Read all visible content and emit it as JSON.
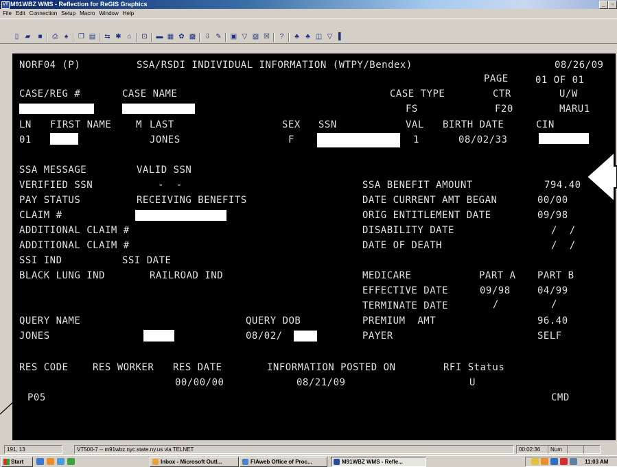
{
  "window": {
    "title": "M91WBZ WMS - Reflection for ReGIS Graphics",
    "icon_label": "VT"
  },
  "menu": [
    "File",
    "Edit",
    "Connection",
    "Setup",
    "Macro",
    "Window",
    "Help"
  ],
  "terminal": {
    "header": {
      "screen_id": "NORF04 (P)",
      "screen_title": "SSA/RSDI INDIVIDUAL INFORMATION (WTPY/Bendex)",
      "date": "08/26/09",
      "page_label": "PAGE",
      "page_value": "01 OF 01"
    },
    "case_row": {
      "case_reg_label": "CASE/REG #",
      "case_name_label": "CASE NAME",
      "case_type_label": "CASE TYPE",
      "ctr_label": "CTR",
      "uw_label": "U/W",
      "case_type_value": "FS",
      "ctr_value": "F20",
      "uw_value": "MARU1"
    },
    "individual": {
      "ln_label": "LN",
      "first_name_label": "FIRST NAME",
      "m_label": "M",
      "last_label": "LAST",
      "sex_label": "SEX",
      "ssn_label": "SSN",
      "val_label": "VAL",
      "birth_date_label": "BIRTH DATE",
      "cin_label": "CIN",
      "ln_value": "01",
      "last_value": "JONES",
      "sex_value": "F",
      "val_value": "1",
      "birth_date_value": "08/02/33"
    },
    "left_fields": {
      "ssa_message_label": "SSA MESSAGE",
      "ssa_message_value": "VALID SSN",
      "verified_ssn_label": "VERIFIED SSN",
      "verified_ssn_value": "-  -",
      "pay_status_label": "PAY STATUS",
      "pay_status_value": "RECEIVING BENEFITS",
      "claim_label": "CLAIM #",
      "additional_claim_label_1": "ADDITIONAL CLAIM #",
      "additional_claim_label_2": "ADDITIONAL CLAIM #",
      "ssi_ind_label": "SSI IND",
      "ssi_date_label": "SSI DATE",
      "black_lung_label": "BLACK LUNG IND",
      "railroad_label": "RAILROAD IND"
    },
    "right_fields": {
      "ssa_benefit_label": "SSA BENEFIT AMOUNT",
      "ssa_benefit_value": "794.40",
      "date_current_amt_label": "DATE CURRENT AMT BEGAN",
      "date_current_amt_value": "00/00",
      "orig_entitlement_label": "ORIG ENTITLEMENT DATE",
      "orig_entitlement_value": "09/98",
      "disability_date_label": "DISABILITY DATE",
      "disability_date_value": "/  /",
      "date_of_death_label": "DATE OF DEATH",
      "date_of_death_value": "/  /"
    },
    "medicare": {
      "label": "MEDICARE",
      "part_a_label": "PART A",
      "part_b_label": "PART B",
      "effective_label": "EFFECTIVE DATE",
      "effective_a": "09/98",
      "effective_b": "04/99",
      "terminate_label": "TERMINATE DATE",
      "terminate_a": "/",
      "terminate_b": "/",
      "premium_label": "PREMIUM  AMT",
      "premium_b": "96.40",
      "payer_label": "PAYER",
      "payer_b": "SELF"
    },
    "query": {
      "name_label": "QUERY NAME",
      "dob_label": "QUERY DOB",
      "name_value": "JONES",
      "dob_value": "08/02/"
    },
    "resolution": {
      "res_code_label": "RES CODE",
      "res_worker_label": "RES WORKER",
      "res_date_label": "RES DATE",
      "info_posted_label": "INFORMATION POSTED ON",
      "rfi_status_label": "RFI Status",
      "res_date_value": "00/00/00",
      "info_posted_value": "08/21/09",
      "rfi_status_value": "U"
    },
    "command": {
      "code": "P05",
      "cmd_label": "CMD"
    }
  },
  "statusbar": {
    "cursor": "191, 13",
    "connection": "VT500-7 -- m91wbz.nyc.state.ny.us via TELNET",
    "timer": "00:02:36",
    "num": "Num"
  },
  "taskbar": {
    "start_label": "Start",
    "tasks": [
      "Inbox - Microsoft Outl...",
      "FIAweb Office of Proc...",
      "M91WBZ  WMS - Refle..."
    ],
    "clock": "11:03 AM"
  },
  "colors": {
    "terminal_bg": "#000000",
    "terminal_text": "#e0e0e0",
    "title_gradient_start": "#0a246a"
  }
}
